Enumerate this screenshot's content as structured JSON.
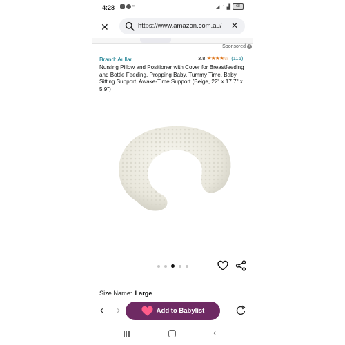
{
  "status_bar": {
    "time": "4:28",
    "battery": "68"
  },
  "browser": {
    "url": "https://www.amazon.com.au/",
    "close_icon": "close-icon",
    "search_icon": "search-icon",
    "clear_icon": "clear-icon"
  },
  "listing": {
    "sponsored_label": "Sponsored",
    "brand": "Brand: Aullar",
    "rating_value": "3.8",
    "rating_stars": "★★★★☆",
    "rating_count": "(116)",
    "title": "Nursing Pillow and Positioner with Cover for Breastfeeding and Bottle Feeding, Propping Baby, Tummy Time, Baby Sitting Support, Awake-Time Support (Beige, 22\" x 17.7\" x 5.9\")",
    "image_count": 5,
    "active_image_index": 2,
    "size_label": "Size Name:",
    "size_value": "Large"
  },
  "toolbar": {
    "back_glyph": "‹",
    "forward_glyph": "›",
    "babylist_label": "Add to Babylist"
  },
  "colors": {
    "accent_link": "#007185",
    "star": "#de7921",
    "babylist_button": "#6e2a63",
    "babylist_heart": "#ff5c8a"
  }
}
